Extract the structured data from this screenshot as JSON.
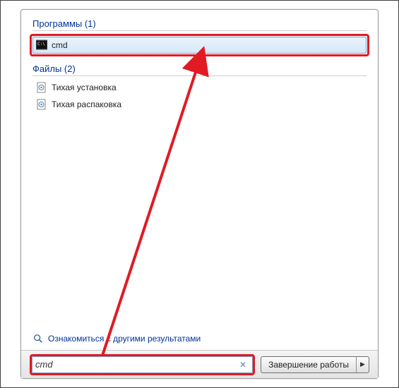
{
  "sections": {
    "programs": {
      "header": "Программы (1)"
    },
    "files": {
      "header": "Файлы (2)"
    }
  },
  "results": {
    "program": {
      "label": "cmd"
    },
    "file1": {
      "label": "Тихая установка"
    },
    "file2": {
      "label": "Тихая распаковка"
    }
  },
  "see_more": {
    "label": "Ознакомиться с другими результатами"
  },
  "search": {
    "value": "cmd"
  },
  "shutdown": {
    "label": "Завершение работы"
  }
}
